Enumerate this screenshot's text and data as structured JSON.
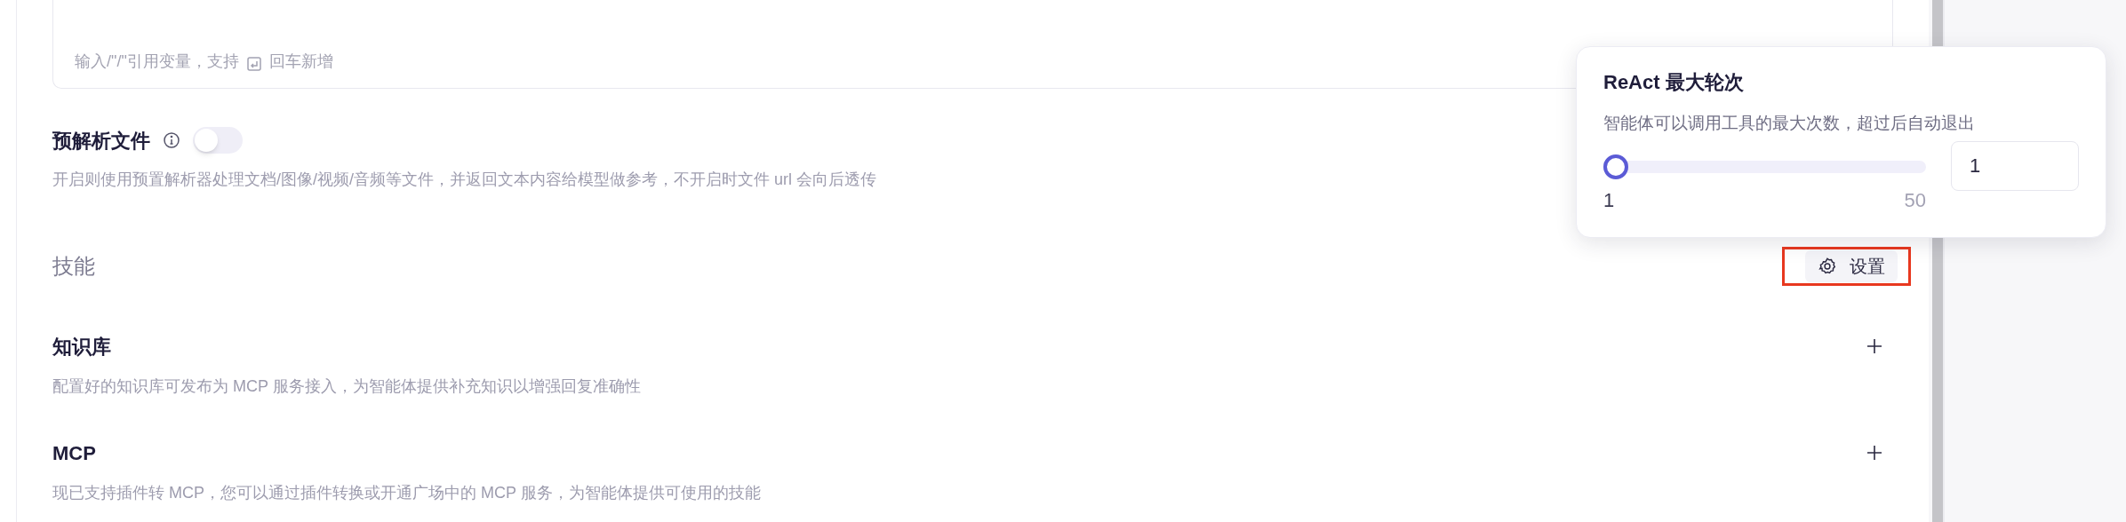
{
  "prompt_field": {
    "placeholder": "输入/\"/\"引用变量，支持",
    "placeholder_suffix": "回车新增"
  },
  "preparse": {
    "label": "预解析文件",
    "on": false,
    "description": "开启则使用预置解析器处理文档/图像/视频/音频等文件，并返回文本内容给模型做参考，不开启时文件 url 会向后透传"
  },
  "skills": {
    "title": "技能",
    "settings_button": "设置",
    "highlighted": true,
    "items": [
      {
        "title": "知识库",
        "description": "配置好的知识库可发布为 MCP 服务接入，为智能体提供补充知识以增强回复准确性"
      },
      {
        "title": "MCP",
        "description": "现已支持插件转 MCP，您可以通过插件转换或开通广场中的 MCP 服务，为智能体提供可使用的技能"
      }
    ]
  },
  "popover": {
    "title": "ReAct 最大轮次",
    "description": "智能体可以调用工具的最大次数，超过后自动退出",
    "slider": {
      "level": 0,
      "min_label": "1",
      "max_label": "50"
    },
    "value": "1"
  }
}
